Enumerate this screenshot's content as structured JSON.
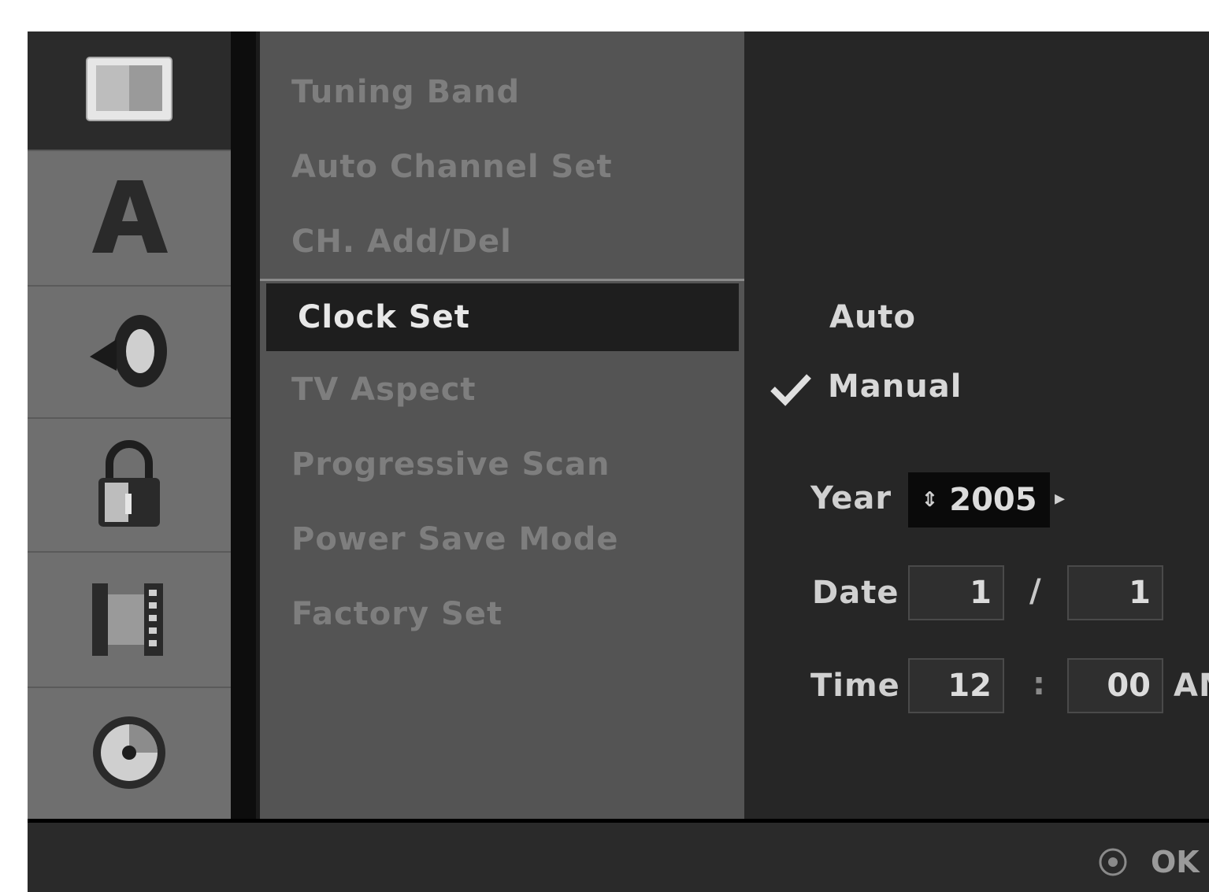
{
  "menu": {
    "items": [
      {
        "label": "Tuning Band"
      },
      {
        "label": "Auto Channel Set"
      },
      {
        "label": "CH. Add/Del"
      },
      {
        "label": "Clock Set"
      },
      {
        "label": "TV Aspect"
      },
      {
        "label": "Progressive Scan"
      },
      {
        "label": "Power Save Mode"
      },
      {
        "label": "Factory Set"
      }
    ],
    "selected": "Clock Set"
  },
  "icons": [
    "tv-icon",
    "letter-a-icon",
    "speaker-icon",
    "lock-icon",
    "film-icon",
    "disc-icon"
  ],
  "clock": {
    "auto_label": "Auto",
    "manual_label": "Manual",
    "selected_mode": "Manual",
    "year_label": "Year",
    "year_value": "2005",
    "date_label": "Date",
    "date_month": "1",
    "date_sep": "/",
    "date_day": "1",
    "time_label": "Time",
    "time_hour": "12",
    "time_sep": ":",
    "time_minute": "00",
    "time_ampm": "AM"
  },
  "footer": {
    "ok_label": "OK"
  },
  "colors": {
    "background": "#1b1b1b",
    "menu_bg": "#545454",
    "icon_col_bg": "#6f6f6f",
    "selected_bg": "#1e1e1e"
  }
}
